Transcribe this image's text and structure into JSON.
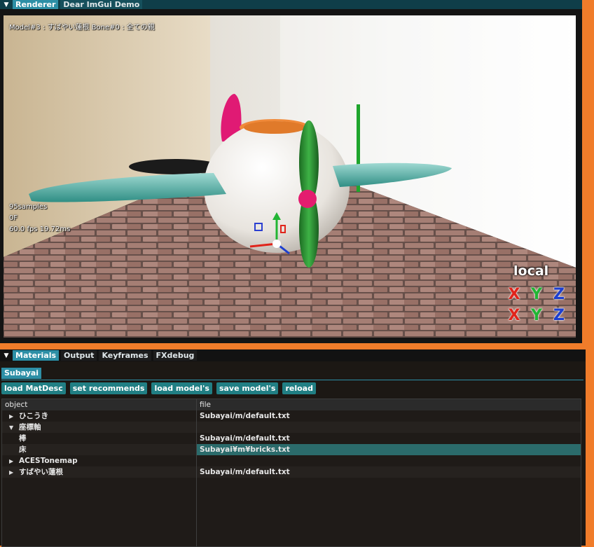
{
  "renderer_window": {
    "tabs": [
      {
        "label": "Renderer",
        "active": true
      },
      {
        "label": "Dear ImGui Demo",
        "active": false
      }
    ],
    "viewport": {
      "model_info": "Model#3 : すばやい蓮根 Bone#0 : 全ての親",
      "samples": "95samples",
      "frame": "0F",
      "fps": "60.0 fps 19.72ms",
      "gizmo_mode": "local",
      "axis_letters": [
        "X",
        "Y",
        "Z"
      ],
      "axis_colors": {
        "x": "#e0241b",
        "y": "#22b534",
        "z": "#1d3fcf"
      }
    }
  },
  "bottom_window": {
    "tabs": [
      {
        "label": "Materials",
        "active": true
      },
      {
        "label": "Output",
        "active": false
      },
      {
        "label": "Keyframes",
        "active": false
      },
      {
        "label": "FXdebug",
        "active": false
      }
    ],
    "subtab": "Subayai",
    "buttons": {
      "load_matdesc": "load MatDesc",
      "set_recommends": "set recommends",
      "load_models": "load model's",
      "save_models": "save model's",
      "reload": "reload"
    },
    "table": {
      "headers": {
        "object": "object",
        "file": "file"
      },
      "rows": [
        {
          "arrow": "▶",
          "object": "ひこうき",
          "file": "Subayai/m/default.txt"
        },
        {
          "arrow": "▼",
          "object": "座標軸",
          "file": ""
        },
        {
          "arrow": "",
          "object": "棒",
          "file": "Subayai/m/default.txt"
        },
        {
          "arrow": "",
          "object": "床",
          "file": "Subayai¥m¥bricks.txt"
        },
        {
          "arrow": "▶",
          "object": "ACESTonemap",
          "file": ""
        },
        {
          "arrow": "▶",
          "object": "すばやい蓮根",
          "file": "Subayai/m/default.txt"
        }
      ]
    }
  },
  "colors": {
    "accent": "#2d8fa6",
    "background_orange": "#f07c2a",
    "selected_row": "#2b6b6b"
  }
}
